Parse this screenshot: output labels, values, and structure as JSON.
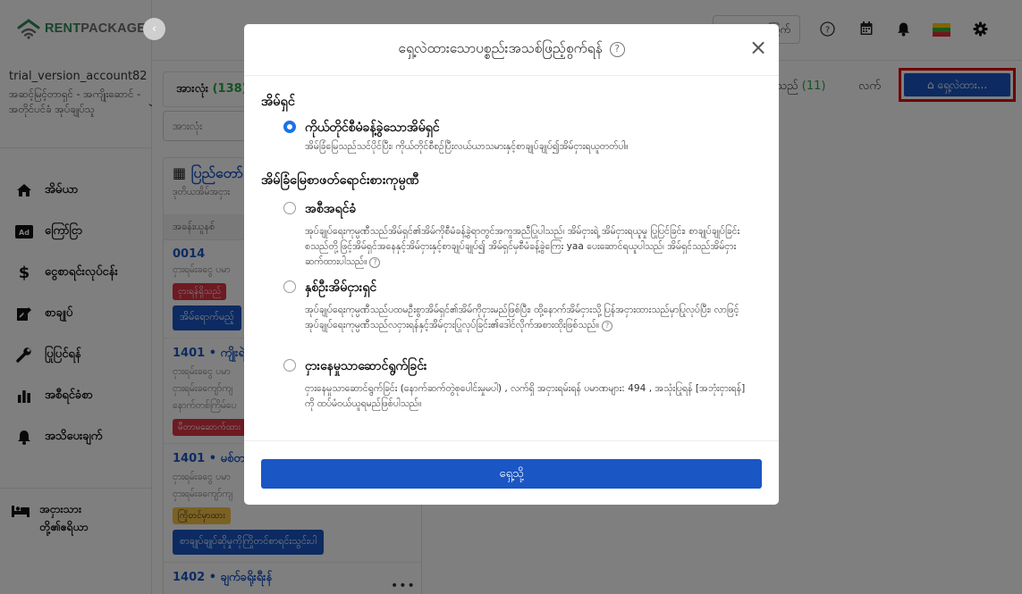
{
  "brand": {
    "part1": "RENT",
    "part2": "PACKAGE",
    "collapse_icon": "‹"
  },
  "account": {
    "name": "trial_version_account82",
    "role": "အဆင့်မြင့်တာရှင် - အကျိုးဆောင် - အတိုင်ပင်ခံ အုပ်ချုပ်သူ"
  },
  "nav": [
    {
      "label": "အိမ်ယာ",
      "icon": "home-icon"
    },
    {
      "label": "ကြော်ငြာ",
      "icon": "ad-icon"
    },
    {
      "label": "ငွေစာရင်းလုပ်ငန်း",
      "icon": "dollar-icon"
    },
    {
      "label": "စာချုပ်",
      "icon": "contract-icon"
    },
    {
      "label": "ပြုပြင်ရန်",
      "icon": "wrench-icon"
    },
    {
      "label": "အစီရင်ခံစာ",
      "icon": "bar-chart-icon"
    },
    {
      "label": "အသိပေးချက်",
      "icon": "bell-icon"
    }
  ],
  "nav_bottom": {
    "label_line1": "အငှားသား",
    "label_line2": "တို့၏ဧရိယာ"
  },
  "topbar": {
    "button_label": "ကြက်"
  },
  "main": {
    "tab_all": "အားလုံး",
    "tab_all_count": "(138)",
    "search_placeholder": "အားလုံး",
    "panel_title": "ပြည်တော်",
    "panel_subtitle": "ဒုတိယအိမ်အငှား",
    "col_header": "အခန်းယူနစ်",
    "units": [
      {
        "title": "0014",
        "line1": "ငှားရမ်းခငွေ ပမာ",
        "badge": "ငှားရန်ရှိသည်",
        "badge_color": "red",
        "button": "အိမ်ရောက်မည့်"
      },
      {
        "title": "1401 • ကျိုးရဲ့ရ",
        "line1": "ငှားရမ်းခငွေ ပမာ",
        "line2": "ငှားရမ်းခကျော်ကျ",
        "line3": "နောက်တစ်ကြိမ်ပေ",
        "badge": "မီတာမဆောက်ထား",
        "badge_color": "red"
      },
      {
        "title": "1401 • မစ်တာ",
        "line1": "ငှားရမ်းခငွေ ပမာ",
        "line2": "ငှားရမ်းခကျော်ကျ",
        "badge": "ကြိုတင်မှာထား",
        "badge_color": "yellow",
        "button": "စာချုပ်ချုပ်ဆိုမှုကိုကြိုတင်စာရင်းသွင်းပါ"
      },
      {
        "title": "1402 • ချက်ခရိုးရီးန်"
      }
    ],
    "right_tab_label": "ရှိသည်",
    "right_tab_count": "(11)",
    "right_tab2": "လက်",
    "rent_button": "ရှေ့လဲထား..."
  },
  "modal": {
    "title": "ရှေ့လဲထားသောပစ္စည်းအသစ်ဖြည့်စွက်ရန်",
    "help_icon_glyph": "?",
    "close_glyph": "×",
    "section_owner": "အိမ်ရှင်",
    "owner_option": {
      "title": "ကိုယ်တိုင်စီမံခန့်ခွဲသောအိမ်ရှင်",
      "desc": "အိမ်ခြံမြေသည်သင်ပိုင်ပြီး၊ ကိုယ်တိုင်စီစဉ်ပြီးလယ်ယာသမားနှင့်စာချုပ်ချုပ်၍အိမ်ငှားရယူတတ်ပါ။",
      "selected": true
    },
    "section_agency": "အိမ်ခြံမြေစာဖတ်ရောင်းစားကုမ္ပဏီ",
    "agency_options": [
      {
        "title": "အစီအရင်ခံ",
        "desc": "အုပ်ချုပ်ရေးကုမ္ပဏီသည်အိမ်ရှင်၏အိမ်ကိုစီမံခန့်ခွဲရာတွင်အကူအညီပြုပါသည်၊ အိမ်ငှားရဲ့ အိမ်ငှားရယူမှု ပြုပြင်ခြင်း၊ စာချုပ်ချုပ်ခြင်းစသည်တို့ဖြင့်အိမ်ရှင်အနေနှင့်အိမ်ငှားနှင့်စာချုပ်ချုပ်၍ အိမ်ရှင်မှစီမံခန့်ခွဲကြေး yaa ပေးဆောင်ရယူပါသည်၊ အိမ်ရှင်သည်အိမ်ငှားဆက်ထားပါသည်။",
        "has_help": true,
        "selected": false
      },
      {
        "title": "နှစ်ဦးအိမ်ငှားရှင်",
        "desc": "အုပ်ချုပ်ရေးကုမ္ပဏီသည်ပထမဦးစွာအိမ်ရှင်၏အိမ်ကိုငှားမည်ဖြစ်ပြီး၊ ထို့နောက်အိမ်ငှားသို့ပြန်အငှားထားသည်မှာပြုလုပ်ပြီး၊ လာဖြင့်အုပ်ချုပ်ရေးကုမ္ပဏီသည်လငှားရန်နှင့်အိမ်ငှားပြုလုပ်ခြင်း၏ဒေါင်လိုက်အစားထိုးဖြစ်သည်။",
        "has_help": true,
        "selected": false
      },
      {
        "title": "ငှားနေမှုသာဆောင်ရွက်ခြင်း",
        "desc": "ငှားနေမှုသာဆောင်ရွက်ခြင်း (နောက်ဆက်တွဲစုပေါင်းမှုမပါ) , လက်ရှိ အငှားရမ်းရန် ပမာဏများ: 494 , အသုံးပြုရန် [အဘုံးငှားရန်] ကို ထပ်မံဝယ်ယူရမည်ဖြစ်ပါသည်။",
        "has_help": false,
        "selected": false
      }
    ],
    "confirm_button": "ရှေ့သို့"
  },
  "colors": {
    "primary": "#1a56c4",
    "radio_active": "#1a73e8",
    "brand_green": "#2e8b57",
    "highlight": "#e00000"
  }
}
